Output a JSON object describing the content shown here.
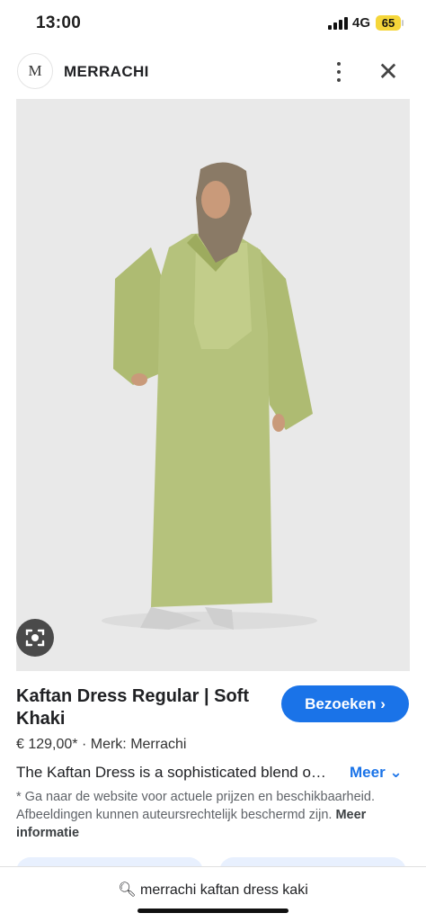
{
  "status_bar": {
    "time": "13:00",
    "network": "4G",
    "battery": "65"
  },
  "header": {
    "logo_letter": "M",
    "site_name": "MERRACHI"
  },
  "product": {
    "title": "Kaftan Dress Regular | Soft Khaki",
    "price": "€ 129,00*",
    "separator": "·",
    "brand": "Merk: Merrachi",
    "description": "The Kaftan Dress is a sophisticated blend o…",
    "more_label": "Meer",
    "visit_label": "Bezoeken",
    "disclaimer": "* Ga naar de website voor actuele prijzen en beschikbaarheid. Afbeeldingen kunnen auteursrechtelijk beschermd zijn.",
    "info_link": "Meer informatie"
  },
  "search": {
    "query": "merrachi kaftan dress kaki"
  },
  "colors": {
    "accent": "#1a73e8",
    "dress": "#b5c27c",
    "hijab": "#8a7a66",
    "image_bg": "#e9e9e9"
  },
  "icons": [
    "more-vertical-icon",
    "close-icon",
    "lens-icon",
    "chevron-right-icon",
    "chevron-down-icon",
    "search-icon"
  ]
}
